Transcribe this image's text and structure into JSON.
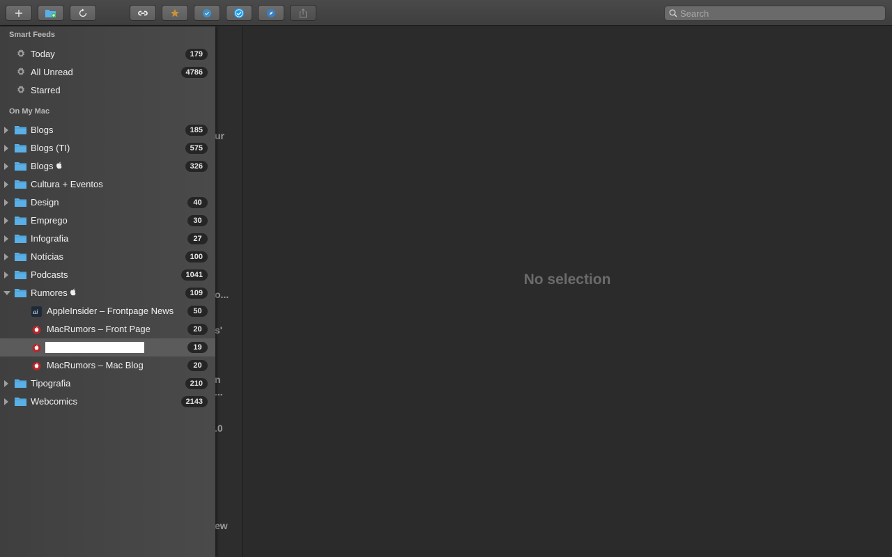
{
  "toolbar": {
    "buttons": [
      {
        "name": "add-button",
        "icon": "plus-icon"
      },
      {
        "name": "new-folder-button",
        "icon": "folder-plus-icon"
      },
      {
        "name": "refresh-button",
        "icon": "refresh-icon"
      },
      {
        "name": "link-button",
        "icon": "link-icon"
      },
      {
        "name": "star-button",
        "icon": "star-icon"
      },
      {
        "name": "mark-read-button",
        "icon": "check-circle-icon"
      },
      {
        "name": "mark-all-read-button",
        "icon": "check-circle-filled-icon"
      },
      {
        "name": "safari-button",
        "icon": "compass-icon"
      },
      {
        "name": "share-button",
        "icon": "share-icon"
      }
    ],
    "search_placeholder": "Search"
  },
  "sidebar": {
    "smart_feeds_header": "Smart Feeds",
    "smart_feeds": [
      {
        "label": "Today",
        "count": "179"
      },
      {
        "label": "All Unread",
        "count": "4786"
      },
      {
        "label": "Starred",
        "count": ""
      }
    ],
    "on_my_mac_header": "On My Mac",
    "folders": [
      {
        "label": "Blogs",
        "count": "185"
      },
      {
        "label": "Blogs (TI)",
        "count": "575"
      },
      {
        "label": "Blogs",
        "count": "326",
        "apple": true
      },
      {
        "label": "Cultura + Eventos",
        "count": ""
      },
      {
        "label": "Design",
        "count": "40"
      },
      {
        "label": "Emprego",
        "count": "30"
      },
      {
        "label": "Infografia",
        "count": "27"
      },
      {
        "label": "Notícias",
        "count": "100"
      },
      {
        "label": "Podcasts",
        "count": "1041"
      },
      {
        "label": "Rumores",
        "count": "109",
        "apple": true,
        "expanded": true
      }
    ],
    "rumores_feeds": [
      {
        "label": "AppleInsider – Frontpage News",
        "count": "50",
        "icon": "appleinsider-icon"
      },
      {
        "label": "MacRumors – Front Page",
        "count": "20",
        "icon": "macrumors-icon"
      },
      {
        "label": "",
        "count": "19",
        "icon": "macrumors-icon",
        "editing": true
      },
      {
        "label": "MacRumors – Mac Blog",
        "count": "20",
        "icon": "macrumors-icon"
      }
    ],
    "folders_after": [
      {
        "label": "Tipografia",
        "count": "210"
      },
      {
        "label": "Webcomics",
        "count": "2143"
      }
    ]
  },
  "list_fragments": [
    "ur",
    "o...",
    "s'",
    "n",
    "...",
    ".0",
    "ew"
  ],
  "detail": {
    "empty_text": "No selection"
  },
  "colors": {
    "folder": "#5ab0e6",
    "accent_blue": "#1f9bea",
    "badge_bg": "#252525"
  }
}
